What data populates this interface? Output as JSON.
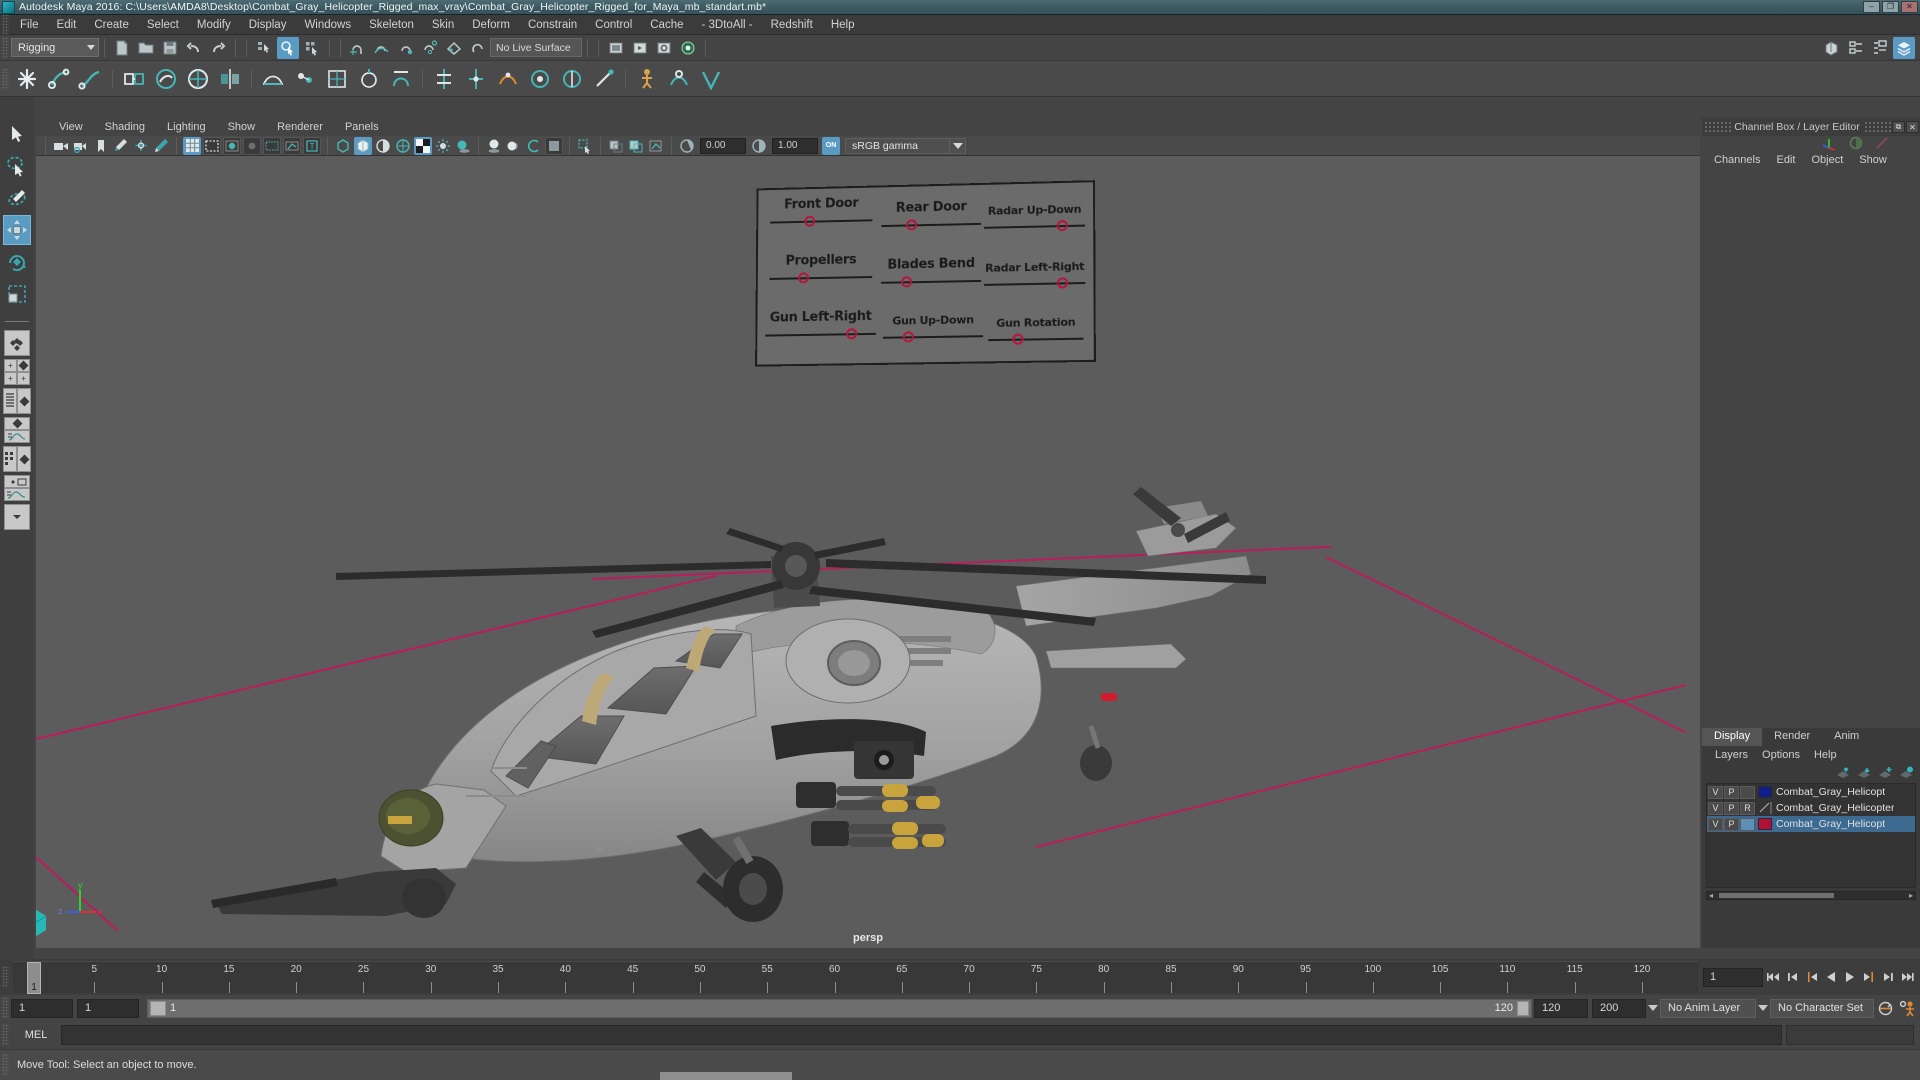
{
  "window": {
    "title": "Autodesk Maya 2016: C:\\Users\\AMDA8\\Desktop\\Combat_Gray_Helicopter_Rigged_max_vray\\Combat_Gray_Helicopter_Rigged_for_Maya_mb_standart.mb*",
    "minimize": "–",
    "maximize": "❐",
    "close": "✕"
  },
  "menubar": {
    "items": [
      "File",
      "Edit",
      "Create",
      "Select",
      "Modify",
      "Display",
      "Windows",
      "Skeleton",
      "Skin",
      "Deform",
      "Constrain",
      "Control",
      "Cache",
      "- 3DtoAll -",
      "Redshift",
      "Help"
    ]
  },
  "toolbar": {
    "menu_set": "Rigging",
    "live_surface": "No Live Surface"
  },
  "viewport": {
    "menus": [
      "View",
      "Shading",
      "Lighting",
      "Show",
      "Renderer",
      "Panels"
    ],
    "exposure": "0.00",
    "gamma_value": "1.00",
    "color_management": "sRGB gamma",
    "cm_toggle": "ON",
    "camera_label": "persp",
    "axis": {
      "x": "x",
      "y": "y",
      "z": "z"
    }
  },
  "control_panel": {
    "sliders": [
      {
        "label": "Front Door",
        "position": 34
      },
      {
        "label": "Rear Door",
        "position": 25
      },
      {
        "label": "Radar Up-Down",
        "position": 72
      },
      {
        "label": "Propellers",
        "position": 28
      },
      {
        "label": "Blades Bend",
        "position": 20
      },
      {
        "label": "Radar Left-Right",
        "position": 72
      },
      {
        "label": "Gun Left-Right",
        "position": 73
      },
      {
        "label": "Gun Up-Down",
        "position": 20
      },
      {
        "label": "Gun Rotation",
        "position": 25
      }
    ]
  },
  "right_panel": {
    "title": "Channel Box / Layer Editor",
    "menus": [
      "Channels",
      "Edit",
      "Object",
      "Show"
    ],
    "layer_tabs": [
      {
        "label": "Display",
        "active": true
      },
      {
        "label": "Render",
        "active": false
      },
      {
        "label": "Anim",
        "active": false
      }
    ],
    "layer_menus": [
      "Layers",
      "Options",
      "Help"
    ],
    "layers": [
      {
        "v": "V",
        "p": "P",
        "r": "",
        "color": "#101f8c",
        "name": "Combat_Gray_Helicopt",
        "selected": false
      },
      {
        "v": "V",
        "p": "P",
        "r": "R",
        "color": "",
        "name": "Combat_Gray_Helicopter",
        "selected": false
      },
      {
        "v": "V",
        "p": "P",
        "r": "",
        "color": "#b01038",
        "name": "Combat_Gray_Helicopt",
        "selected": true
      }
    ]
  },
  "timeline": {
    "ticks": [
      5,
      10,
      15,
      20,
      25,
      30,
      35,
      40,
      45,
      50,
      55,
      60,
      65,
      70,
      75,
      80,
      85,
      90,
      95,
      100,
      105,
      110,
      115,
      120
    ],
    "current_frame_marker": "1",
    "current_frame_field": "1"
  },
  "range": {
    "start": "1",
    "end": "1",
    "slider_start_label": "1",
    "slider_end_label": "120",
    "playback_end": "120",
    "anim_end": "200",
    "anim_layer": "No Anim Layer",
    "character_set": "No Character Set"
  },
  "command_line": {
    "language": "MEL",
    "input_value": ""
  },
  "status": {
    "message": "Move Tool: Select an object to move."
  }
}
